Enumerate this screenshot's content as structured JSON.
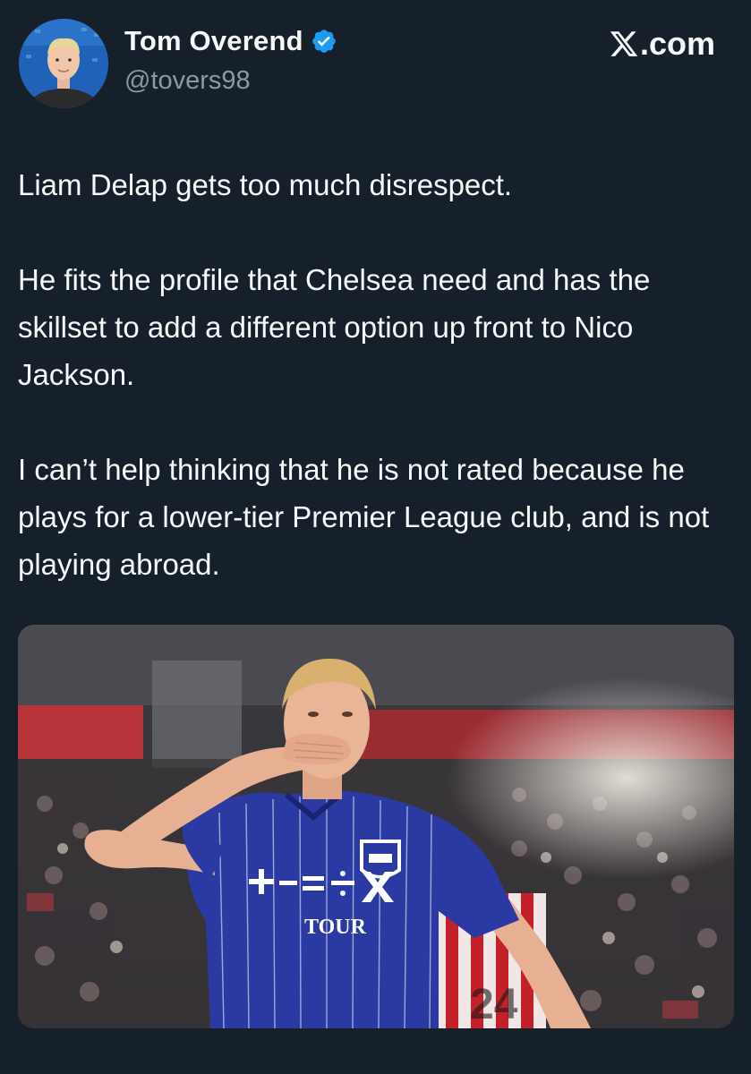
{
  "author": {
    "name": "Tom Overend",
    "handle": "@tovers98",
    "verified": true,
    "avatar_icon": "profile-photo"
  },
  "brand": {
    "label": ".com",
    "logo_icon": "x-logo-icon"
  },
  "tweet": {
    "paragraphs": [
      "Liam Delap gets too much disrespect.",
      "He fits the profile that Chelsea need and has the skillset to add a different option up front to Nico Jackson.",
      "I can’t help thinking that he is not rated because he plays for a lower-tier Premier League club, and is not playing abroad."
    ]
  },
  "media": {
    "kind": "photo",
    "shirt_sponsor": "TOUR",
    "rival_number": "24"
  },
  "colors": {
    "background": "#15202b",
    "text": "#f7f9f9",
    "muted": "#8b98a5",
    "verified": "#1d9bf0",
    "kit_blue": "#2b3aa3"
  }
}
